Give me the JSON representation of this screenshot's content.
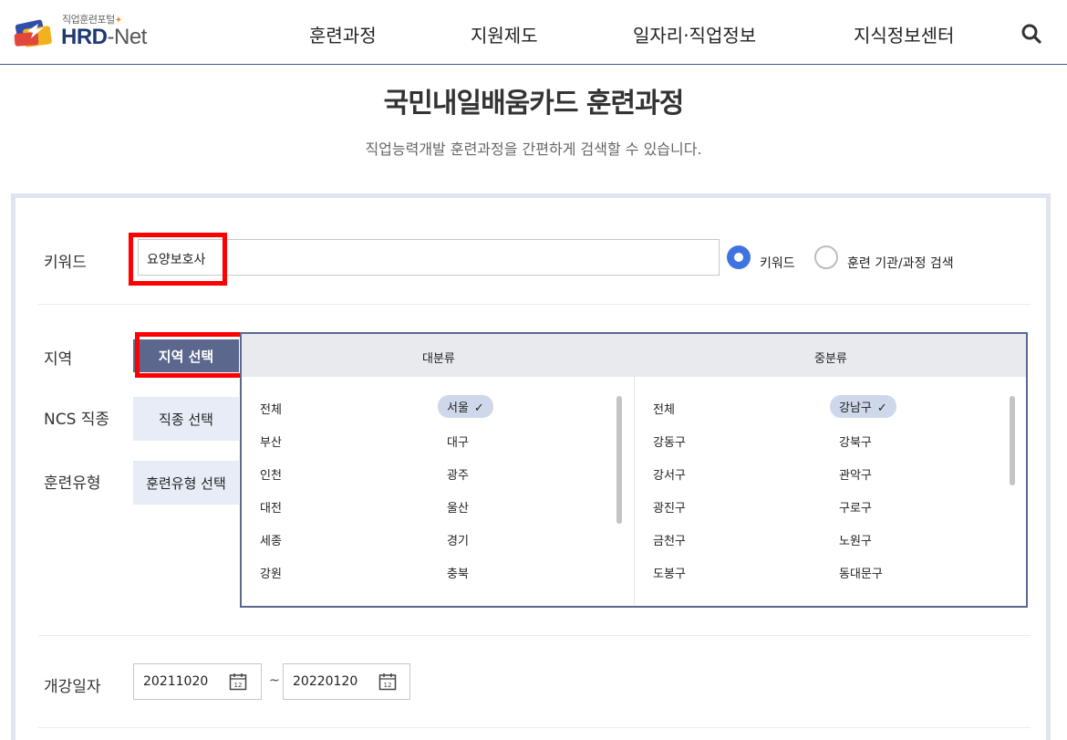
{
  "header": {
    "logo_sub": "직업훈련포털",
    "logo_main_a": "HRD",
    "logo_main_b": "-Net",
    "nav": [
      "훈련과정",
      "지원제도",
      "일자리·직업정보",
      "지식정보센터"
    ],
    "search_icon": "search-icon"
  },
  "page": {
    "title": "국민내일배움카드 훈련과정",
    "description": "직업능력개발 훈련과정을 간편하게 검색할 수 있습니다."
  },
  "search": {
    "keyword_label": "키워드",
    "keyword_value": "요양보호사",
    "radio_keyword": "키워드",
    "radio_institution": "훈련 기관/과정 검색",
    "selected_radio": "키워드",
    "region_label": "지역",
    "region_button": "지역 선택",
    "ncs_label": "NCS 직종",
    "ncs_button": "직종 선택",
    "type_label": "훈련유형",
    "type_button": "훈련유형 선택",
    "date_label": "개강일자",
    "date_from": "20211020",
    "date_to": "20220120",
    "date_separator": "~"
  },
  "region_selector": {
    "major_title": "대분류",
    "minor_title": "중분류",
    "major_items": [
      "전체",
      "서울",
      "부산",
      "대구",
      "인천",
      "광주",
      "대전",
      "울산",
      "세종",
      "경기",
      "강원",
      "충북"
    ],
    "major_selected": "서울",
    "minor_items": [
      "전체",
      "강남구",
      "강동구",
      "강북구",
      "강서구",
      "관악구",
      "광진구",
      "구로구",
      "금천구",
      "노원구",
      "도봉구",
      "동대문구"
    ],
    "minor_selected": "강남구",
    "check_glyph": "✓"
  },
  "colors": {
    "accent_blue": "#3f73e0",
    "button_active": "#5c678e",
    "highlight_red": "#ff0000",
    "brand_navy": "#1e3a73"
  }
}
